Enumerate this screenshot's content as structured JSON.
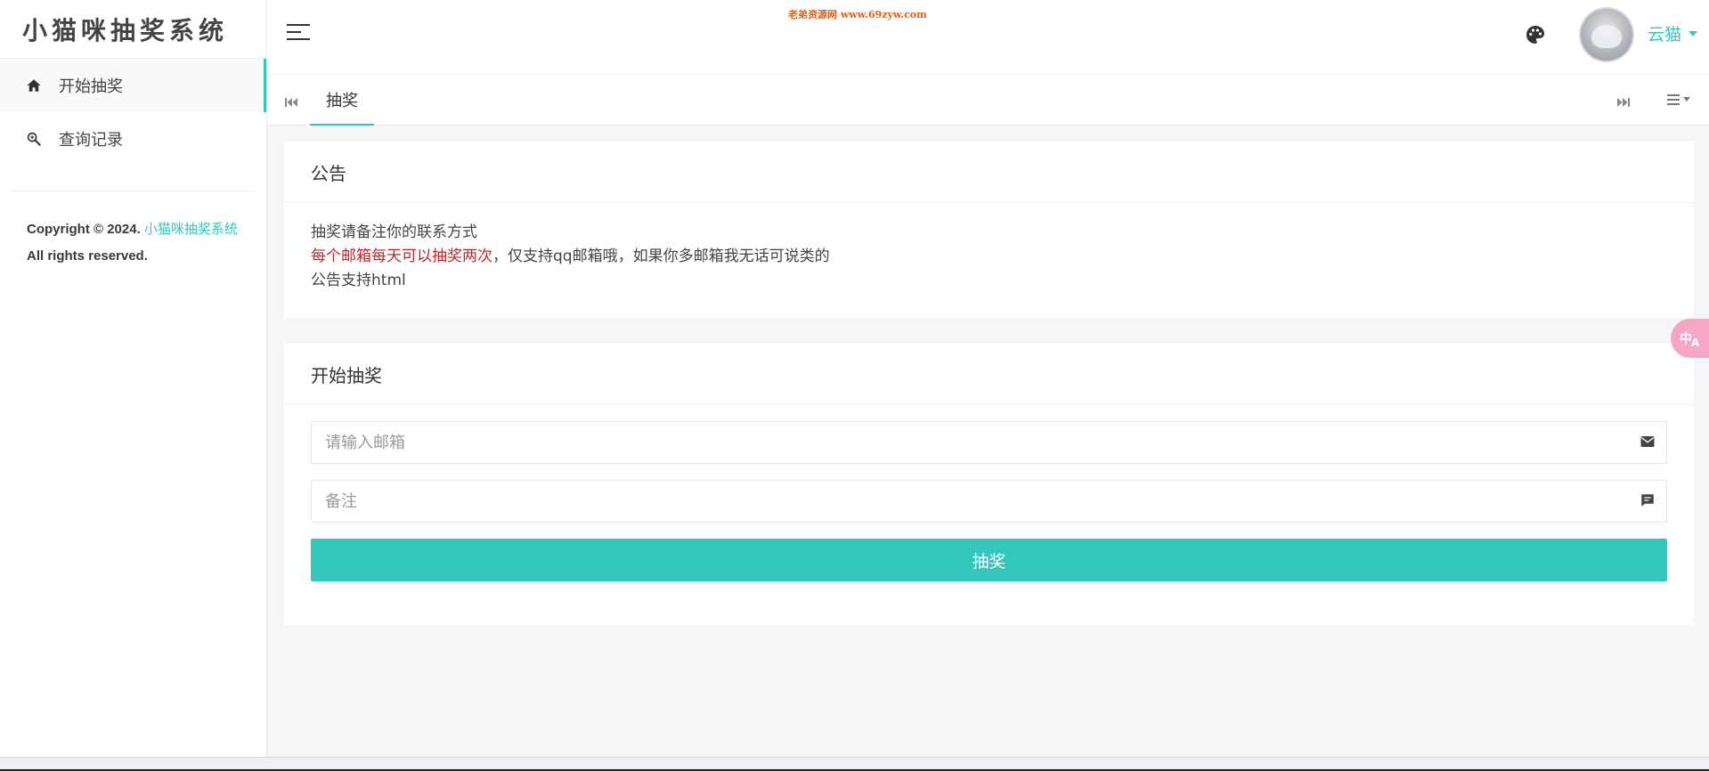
{
  "app": {
    "logo_text": "小猫咪抽奖系统",
    "watermark": "老弟资源网 www.69zyw.com"
  },
  "sidebar": {
    "items": [
      {
        "label": "开始抽奖",
        "icon": "home-icon",
        "active": true
      },
      {
        "label": "查询记录",
        "icon": "search-zoom-icon",
        "active": false
      }
    ],
    "copyright": {
      "prefix": "Copyright © 2024. ",
      "brand": "小猫咪抽奖系统",
      "suffix": " All rights reserved."
    }
  },
  "header": {
    "username": "云猫",
    "palette_icon": "palette-icon",
    "menu_icon": "hamburger-icon"
  },
  "tabs": {
    "items": [
      {
        "label": "抽奖",
        "active": true
      }
    ]
  },
  "notice": {
    "title": "公告",
    "line1": "抽奖请备注你的联系方式",
    "line2_red": "每个邮箱每天可以抽奖两次",
    "line2_rest": "，仅支持qq邮箱哦，如果你多邮箱我无话可说类的",
    "line3": "公告支持html"
  },
  "lottery": {
    "title": "开始抽奖",
    "email_placeholder": "请输入邮箱",
    "email_value": "",
    "remark_placeholder": "备注",
    "remark_value": "",
    "submit_label": "抽奖"
  },
  "colors": {
    "accent": "#33c6bc",
    "notice_red": "#c0272d",
    "background": "#f5f6f8"
  }
}
